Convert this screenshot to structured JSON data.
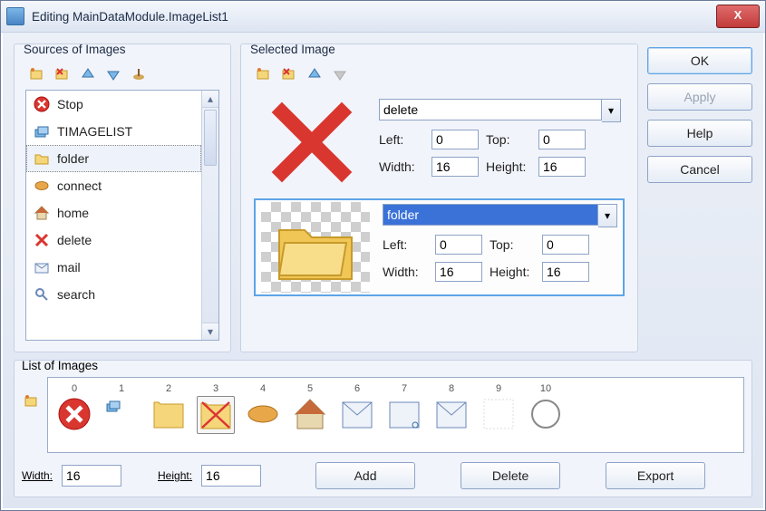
{
  "title": "Editing MainDataModule.ImageList1",
  "sources": {
    "label": "Sources of Images",
    "items": [
      {
        "label": "Stop",
        "icon": "stop",
        "selected": false
      },
      {
        "label": "TIMAGELIST",
        "icon": "stack",
        "selected": false
      },
      {
        "label": "folder",
        "icon": "folder",
        "selected": true
      },
      {
        "label": "connect",
        "icon": "connect",
        "selected": false
      },
      {
        "label": "home",
        "icon": "home",
        "selected": false
      },
      {
        "label": "delete",
        "icon": "x",
        "selected": false
      },
      {
        "label": "mail",
        "icon": "mail",
        "selected": false
      },
      {
        "label": "search",
        "icon": "search",
        "selected": false
      }
    ]
  },
  "selected": {
    "label": "Selected Image",
    "rows": [
      {
        "name": "delete",
        "icon": "bigx",
        "left": "0",
        "top": "0",
        "width": "16",
        "height": "16",
        "active": false
      },
      {
        "name": "folder",
        "icon": "bigfolder",
        "left": "0",
        "top": "0",
        "width": "16",
        "height": "16",
        "active": true
      }
    ],
    "field_labels": {
      "left": "Left:",
      "top": "Top:",
      "width": "Width:",
      "height": "Height:"
    }
  },
  "buttons": {
    "ok": "OK",
    "apply": "Apply",
    "help": "Help",
    "cancel": "Cancel"
  },
  "list": {
    "label": "List of Images",
    "thumbs": [
      {
        "n": "0",
        "icon": "stopcircle"
      },
      {
        "n": "1",
        "icon": "stack"
      },
      {
        "n": "2",
        "icon": "folderflat"
      },
      {
        "n": "3",
        "icon": "folderx",
        "sel": true
      },
      {
        "n": "4",
        "icon": "connect"
      },
      {
        "n": "5",
        "icon": "home"
      },
      {
        "n": "6",
        "icon": "mail"
      },
      {
        "n": "7",
        "icon": "mailsearch"
      },
      {
        "n": "8",
        "icon": "mail"
      },
      {
        "n": "9",
        "icon": "blank"
      },
      {
        "n": "10",
        "icon": "ring"
      }
    ]
  },
  "footer": {
    "width_label": "Width:",
    "width": "16",
    "height_label": "Height:",
    "height": "16",
    "add": "Add",
    "delete": "Delete",
    "export": "Export"
  }
}
